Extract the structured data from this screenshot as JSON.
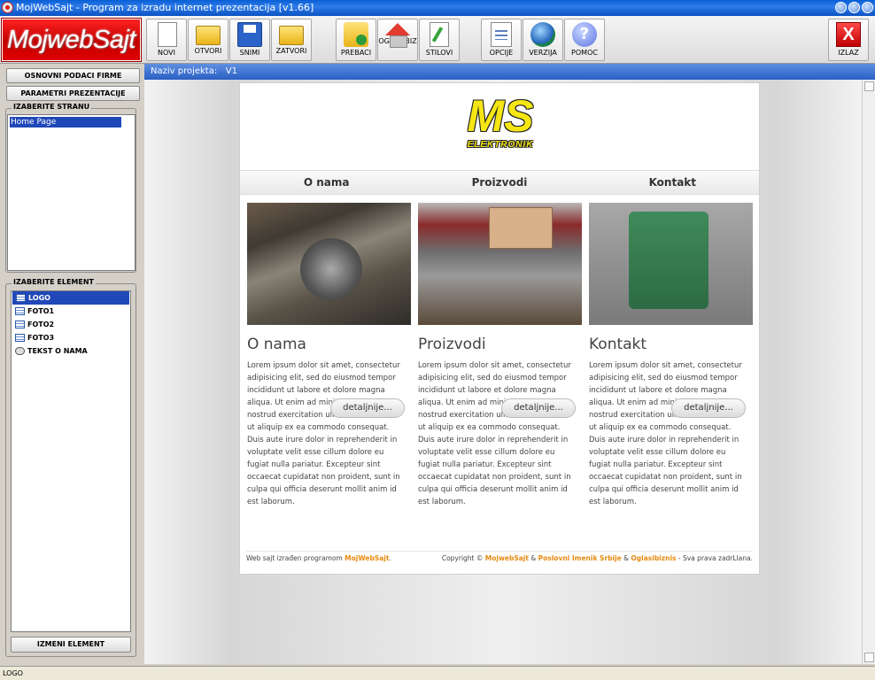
{
  "window": {
    "title": "MojWebSajt - Program za izradu internet prezentacija   [v1.66]"
  },
  "toolbar": {
    "logo": "MojwebSajt",
    "buttons": [
      {
        "label": "NOVI",
        "icon": "new-page-icon"
      },
      {
        "label": "OTVORI",
        "icon": "open-folder-icon"
      },
      {
        "label": "SNIMI",
        "icon": "save-disk-icon"
      },
      {
        "label": "ZATVORI",
        "icon": "close-folder-icon"
      },
      {
        "label": "PREBACI",
        "icon": "transfer-icon"
      },
      {
        "label": "OGLASIBIZ",
        "icon": "house-icon"
      },
      {
        "label": "STILOVI",
        "icon": "style-pen-icon"
      },
      {
        "label": "OPCIJE",
        "icon": "options-icon"
      },
      {
        "label": "VERZIJA",
        "icon": "globe-icon"
      },
      {
        "label": "POMOC",
        "icon": "help-icon"
      },
      {
        "label": "IZLAZ",
        "icon": "exit-x-icon"
      }
    ]
  },
  "sidebar": {
    "btn_company": "OSNOVNI PODACI FIRME",
    "btn_params": "PARAMETRI PREZENTACIJE",
    "pages_title": "IZABERITE STRANU",
    "pages": [
      "Home Page"
    ],
    "elements_title": "IZABERITE ELEMENT",
    "elements": [
      {
        "label": "LOGO",
        "selected": true
      },
      {
        "label": "FOTO1",
        "selected": false
      },
      {
        "label": "FOTO2",
        "selected": false
      },
      {
        "label": "FOTO3",
        "selected": false
      },
      {
        "label": "TEKST O NAMA",
        "selected": false
      }
    ],
    "btn_edit": "IZMENI ELEMENT"
  },
  "project": {
    "label": "Naziv projekta:",
    "name": "V1"
  },
  "preview": {
    "logo_big": "MS",
    "logo_small": "ELEKTRONIK",
    "nav": [
      "O nama",
      "Proizvodi",
      "Kontakt"
    ],
    "columns": [
      {
        "title": "O nama",
        "text": "Lorem ipsum dolor sit amet, consectetur adipisicing elit, sed do eiusmod tempor incididunt ut labore et dolore magna aliqua. Ut enim ad minim veniam, quis nostrud exercitation ullamco laboris nisi ut aliquip ex ea commodo consequat. Duis aute irure dolor in reprehenderit in voluptate velit esse cillum dolore eu fugiat nulla pariatur. Excepteur sint occaecat cupidatat non proident, sunt in culpa qui officia deserunt mollit anim id est laborum.",
        "button": "detaljnije..."
      },
      {
        "title": "Proizvodi",
        "text": "Lorem ipsum dolor sit amet, consectetur adipisicing elit, sed do eiusmod tempor incididunt ut labore et dolore magna aliqua. Ut enim ad minim veniam, quis nostrud exercitation ullamco laboris nisi ut aliquip ex ea commodo consequat. Duis aute irure dolor in reprehenderit in voluptate velit esse cillum dolore eu fugiat nulla pariatur. Excepteur sint occaecat cupidatat non proident, sunt in culpa qui officia deserunt mollit anim id est laborum.",
        "button": "detaljnije..."
      },
      {
        "title": "Kontakt",
        "text": "Lorem ipsum dolor sit amet, consectetur adipisicing elit, sed do eiusmod tempor incididunt ut labore et dolore magna aliqua. Ut enim ad minim veniam, quis nostrud exercitation ullamco laboris nisi ut aliquip ex ea commodo consequat. Duis aute irure dolor in reprehenderit in voluptate velit esse cillum dolore eu fugiat nulla pariatur. Excepteur sint occaecat cupidatat non proident, sunt in culpa qui officia deserunt mollit anim id est laborum.",
        "button": "detaljnije..."
      }
    ],
    "footer_left_prefix": "Web sajt izrađen programom",
    "footer_left_link": "MojWebSajt",
    "footer_right_prefix": "Copyright ©",
    "footer_right_link1": "MojwebSajt",
    "footer_amp": "&",
    "footer_right_link2": "Poslovni Imenik Srbije",
    "footer_right_link3": "Oglasibiznis",
    "footer_right_suffix": "- Sva prava zadrLlana."
  },
  "status": {
    "text": "LOGO"
  },
  "colors": {
    "accent": "#2048b8",
    "brand_red": "#d00000",
    "logo_yellow": "#f5e614",
    "footer_link": "#e68a10"
  }
}
